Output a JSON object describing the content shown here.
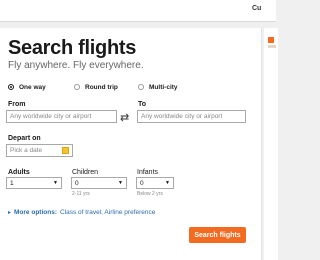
{
  "header": {
    "currency_partial": "Cu"
  },
  "form": {
    "title": "Search flights",
    "subtitle": "Fly anywhere. Fly everywhere.",
    "trip_types": [
      {
        "label": "One way",
        "selected": true
      },
      {
        "label": "Round trip",
        "selected": false
      },
      {
        "label": "Multi-city",
        "selected": false
      }
    ],
    "from": {
      "label": "From",
      "placeholder": "Any worldwide city or airport"
    },
    "to": {
      "label": "To",
      "placeholder": "Any worldwide city or airport"
    },
    "swap_icon": "swap-arrows-icon",
    "depart": {
      "label": "Depart on",
      "placeholder": "Pick a date"
    },
    "adults": {
      "label": "Adults",
      "value": "1"
    },
    "children": {
      "label": "Children",
      "value": "0",
      "hint": "2-11 yrs"
    },
    "infants": {
      "label": "Infants",
      "value": "0",
      "hint": "Below 2 yrs"
    },
    "more_options": {
      "label": "More options:",
      "detail": "Class of travel, Airline preference"
    },
    "search_button": "Search flights"
  },
  "colors": {
    "accent": "#f26b21",
    "link": "#2a6db0"
  }
}
